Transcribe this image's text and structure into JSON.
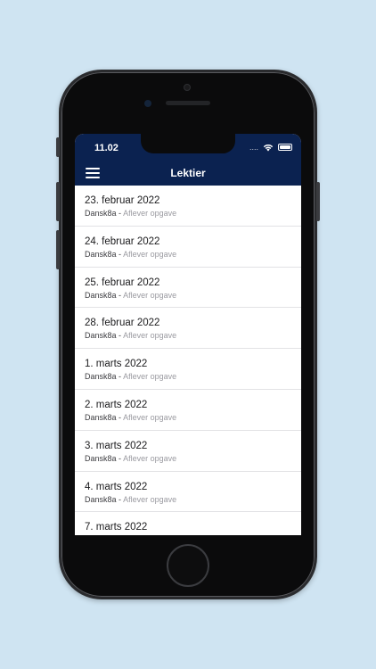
{
  "status_bar": {
    "time": "11.02",
    "signal": "....",
    "wifi_icon": "wifi-icon",
    "battery_icon": "battery-icon"
  },
  "navbar": {
    "menu_icon": "hamburger-menu-icon",
    "title": "Lektier"
  },
  "separator": "-",
  "homework": [
    {
      "date": "23. februar 2022",
      "course": "Dansk8a",
      "task": "Aflever opgave"
    },
    {
      "date": "24. februar 2022",
      "course": "Dansk8a",
      "task": "Aflever opgave"
    },
    {
      "date": "25. februar 2022",
      "course": "Dansk8a",
      "task": "Aflever opgave"
    },
    {
      "date": "28. februar 2022",
      "course": "Dansk8a",
      "task": "Aflever opgave"
    },
    {
      "date": "1. marts 2022",
      "course": "Dansk8a",
      "task": "Aflever opgave"
    },
    {
      "date": "2. marts 2022",
      "course": "Dansk8a",
      "task": "Aflever opgave"
    },
    {
      "date": "3. marts 2022",
      "course": "Dansk8a",
      "task": "Aflever opgave"
    },
    {
      "date": "4. marts 2022",
      "course": "Dansk8a",
      "task": "Aflever opgave"
    },
    {
      "date": "7. marts 2022"
    }
  ],
  "colors": {
    "navbar_bg": "#0b2250",
    "page_bg": "#cfe4f2",
    "subtitle_gray": "#9a9aa0"
  }
}
